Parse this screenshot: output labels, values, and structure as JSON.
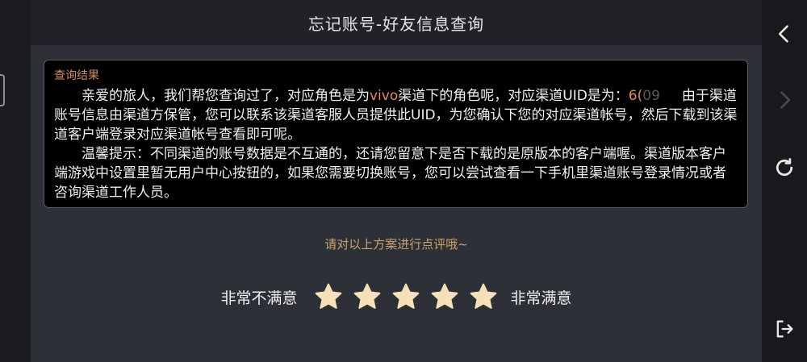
{
  "header": {
    "title": "忘记账号-好友信息查询"
  },
  "result": {
    "title": "查询结果",
    "para1_part1": "亲爱的旅人，我们帮您查询过了，对应角色是为",
    "para1_channel": "vivo",
    "para1_part2": "渠道下的角色呢，对应渠道UID是为：",
    "para1_uid_visible": "6(",
    "para1_obscured": "09     ",
    "para1_part3": "由于渠道账号信息由渠道方保管，您可以联系该渠道客服人员提供此UID，为您确认下您的对应渠道帐号，然后下载到该渠道客户端登录对应渠道帐号查看即可呢。",
    "para2": "温馨提示：不同渠道的账号数据是不互通的，还请您留意下是否下载的是原版本的客户端喔。渠道版本客户端游戏中设置里暂无用户中心按钮的，如果您需要切换账号，您可以尝试查看一下手机里渠道账号登录情况或者咨询渠道工作人员。"
  },
  "rating": {
    "prompt": "请对以上方案进行点评哦~",
    "low_label": "非常不满意",
    "high_label": "非常满意",
    "star_count": 5,
    "selected": 0
  },
  "colors": {
    "accent": "#e9875a",
    "prompt": "#c9a36b",
    "star": "#f3e2b8"
  },
  "sidebar": {
    "icons": [
      "back-icon",
      "forward-icon",
      "refresh-icon",
      "exit-icon"
    ]
  }
}
